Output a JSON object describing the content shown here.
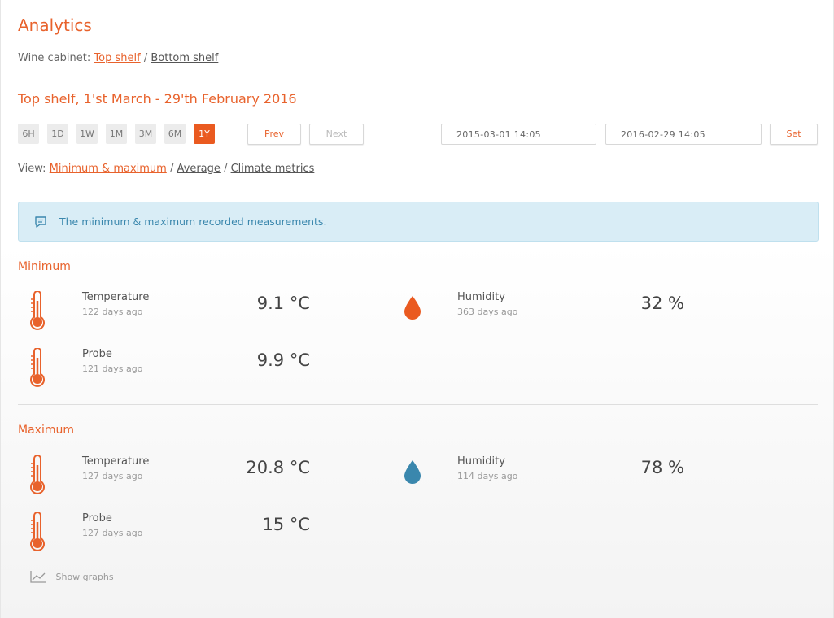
{
  "header": {
    "title": "Analytics",
    "cabinet_label": "Wine cabinet:",
    "cabinet_options": [
      "Top shelf",
      "Bottom shelf"
    ],
    "separator": "/",
    "subtitle": "Top shelf, 1'st March - 29'th February 2016"
  },
  "range": {
    "buttons": [
      "6H",
      "1D",
      "1W",
      "1M",
      "3M",
      "6M",
      "1Y"
    ],
    "selected": "1Y",
    "prev_label": "Prev",
    "next_label": "Next",
    "from_value": "2015-03-01 14:05",
    "to_value": "2016-02-29 14:05",
    "set_label": "Set"
  },
  "view": {
    "label": "View:",
    "options": [
      "Minimum & maximum",
      "Average",
      "Climate metrics"
    ],
    "selected": "Minimum & maximum"
  },
  "alert": {
    "message": "The minimum & maximum recorded measurements.",
    "icon": "comment-icon"
  },
  "minimum": {
    "title": "Minimum",
    "temperature": {
      "label": "Temperature",
      "ago": "122 days ago",
      "value": "9.1 °C",
      "icon": "thermometer-icon"
    },
    "humidity": {
      "label": "Humidity",
      "ago": "363 days ago",
      "value": "32 %",
      "icon": "drop-icon"
    },
    "probe": {
      "label": "Probe",
      "ago": "121 days ago",
      "value": "9.9 °C",
      "icon": "thermometer-icon"
    }
  },
  "maximum": {
    "title": "Maximum",
    "temperature": {
      "label": "Temperature",
      "ago": "127 days ago",
      "value": "20.8 °C",
      "icon": "thermometer-icon"
    },
    "humidity": {
      "label": "Humidity",
      "ago": "114 days ago",
      "value": "78 %",
      "icon": "drop-icon"
    },
    "probe": {
      "label": "Probe",
      "ago": "127 days ago",
      "value": "15 °C",
      "icon": "thermometer-icon"
    }
  },
  "footer": {
    "graphs_label": "Show graphs",
    "icon": "line-chart-icon"
  },
  "colors": {
    "accent": "#e8622c",
    "min_drop": "#ea5a20",
    "max_drop": "#3a87ad",
    "alert_bg": "#d9edf6"
  }
}
